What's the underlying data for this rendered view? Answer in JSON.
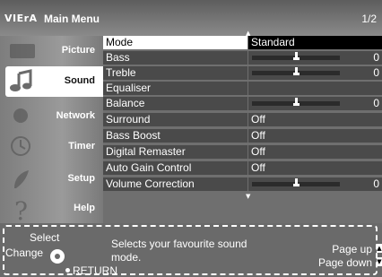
{
  "header": {
    "brand": "VIErA",
    "title": "Main Menu",
    "page": "1/2"
  },
  "sidebar": {
    "items": [
      {
        "label": "Picture",
        "icon": "picture-icon"
      },
      {
        "label": "Sound",
        "icon": "sound-icon",
        "active": true
      },
      {
        "label": "Network",
        "icon": "network-icon"
      },
      {
        "label": "Timer",
        "icon": "timer-icon"
      },
      {
        "label": "Setup",
        "icon": "setup-icon"
      },
      {
        "label": "Help",
        "icon": "help-icon"
      }
    ]
  },
  "menu": {
    "rows": [
      {
        "name": "Mode",
        "value": "Standard",
        "selected": true
      },
      {
        "name": "Bass",
        "value": "0",
        "slider": 0.5
      },
      {
        "name": "Treble",
        "value": "0",
        "slider": 0.5
      },
      {
        "name": "Equaliser",
        "value": ""
      },
      {
        "name": "Balance",
        "value": "0",
        "slider": 0.5
      },
      {
        "name": "Surround",
        "value": "Off"
      },
      {
        "name": "Bass Boost",
        "value": "Off"
      },
      {
        "name": "Digital Remaster",
        "value": "Off"
      },
      {
        "name": "Auto Gain Control",
        "value": "Off"
      },
      {
        "name": "Volume Correction",
        "value": "0",
        "slider": 0.5
      }
    ]
  },
  "help": {
    "select": "Select",
    "change": "Change",
    "return": "RETURN",
    "description_line1": "Selects your favourite sound",
    "description_line2": "mode.",
    "page_up": "Page up",
    "page_down": "Page down"
  },
  "colors": {
    "row_bg": "#4a4a4a",
    "selected_name_bg": "#ffffff",
    "selected_value_bg": "#000000",
    "panel_bg": "#6f6f6f"
  }
}
